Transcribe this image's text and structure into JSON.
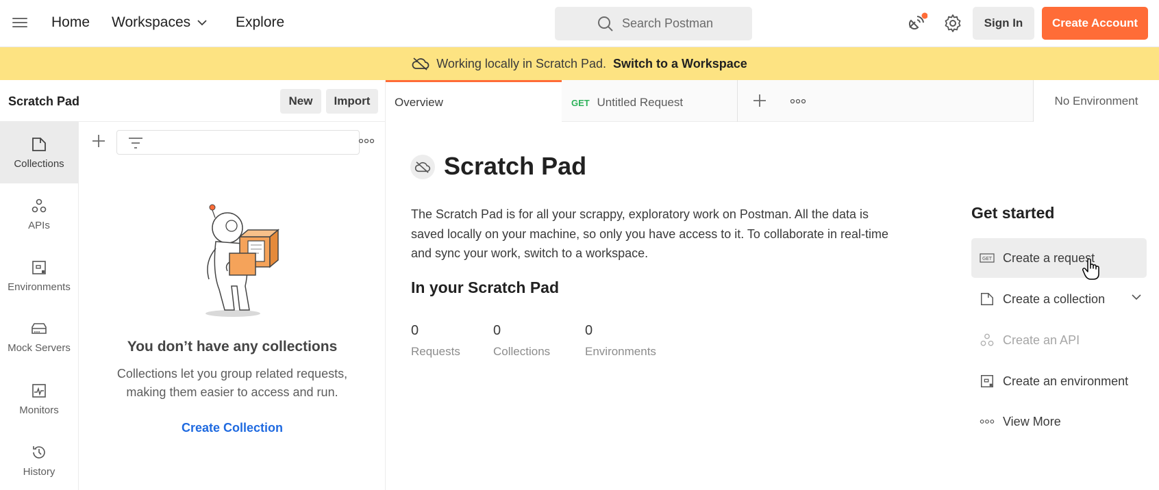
{
  "topbar": {
    "nav": {
      "home": "Home",
      "workspaces": "Workspaces",
      "explore": "Explore"
    },
    "search_placeholder": "Search Postman",
    "sign_in": "Sign In",
    "create_account": "Create Account"
  },
  "banner": {
    "text": "Working locally in Scratch Pad.",
    "link": "Switch to a Workspace"
  },
  "left": {
    "title": "Scratch Pad",
    "new_label": "New",
    "import_label": "Import",
    "sidenav": [
      {
        "label": "Collections",
        "icon": "collections-icon"
      },
      {
        "label": "APIs",
        "icon": "apis-icon"
      },
      {
        "label": "Environments",
        "icon": "environments-icon"
      },
      {
        "label": "Mock Servers",
        "icon": "mock-servers-icon"
      },
      {
        "label": "Monitors",
        "icon": "monitors-icon"
      },
      {
        "label": "History",
        "icon": "history-icon"
      }
    ],
    "empty_title": "You don’t have any collections",
    "empty_desc_line1": "Collections let you group related requests,",
    "empty_desc_line2": "making them easier to access and run.",
    "create_collection": "Create Collection"
  },
  "tabs": {
    "overview": "Overview",
    "request_method": "GET",
    "request_name": "Untitled Request",
    "environment": "No Environment"
  },
  "overview": {
    "title": "Scratch Pad",
    "description": "The Scratch Pad is for all your scrappy, exploratory work on Postman. All the data is saved locally on your machine, so only you have access to it. To collaborate in real-time and sync your work, switch to a workspace.",
    "section_title": "In your Scratch Pad",
    "stats": [
      {
        "value": "0",
        "label": "Requests"
      },
      {
        "value": "0",
        "label": "Collections"
      },
      {
        "value": "0",
        "label": "Environments"
      }
    ]
  },
  "get_started": {
    "title": "Get started",
    "items": [
      {
        "label": "Create a request",
        "icon": "request-icon"
      },
      {
        "label": "Create a collection",
        "icon": "collection-icon"
      },
      {
        "label": "Create an API",
        "icon": "api-icon"
      },
      {
        "label": "Create an environment",
        "icon": "environment-icon"
      },
      {
        "label": "View More",
        "icon": "more-icon"
      }
    ]
  },
  "colors": {
    "accent": "#ff6c37",
    "banner": "#fde382",
    "link": "#1f6ae0",
    "get_method": "#2eb15a"
  }
}
